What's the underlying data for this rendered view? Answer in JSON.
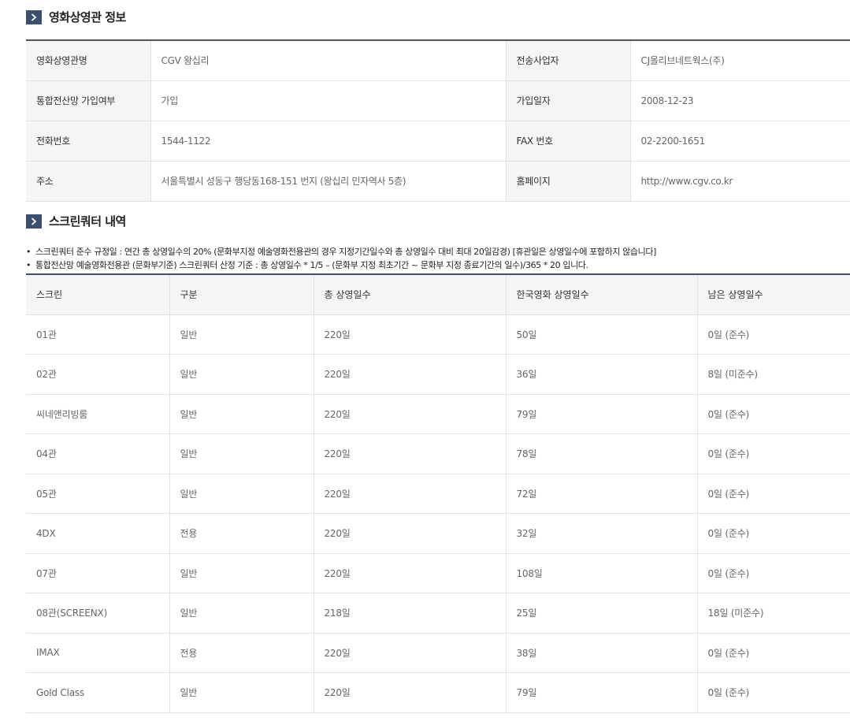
{
  "theater_section": {
    "title": "영화상영관 정보"
  },
  "theater_info": {
    "rows": [
      {
        "label1": "영화상영관명",
        "value1": "CGV 왕십리",
        "label2": "전송사업자",
        "value2": "CJ올리브네트웍스(주)"
      },
      {
        "label1": "통합전산망 가입여부",
        "value1": "가입",
        "label2": "가입일자",
        "value2": "2008-12-23"
      },
      {
        "label1": "전화번호",
        "value1": "1544-1122",
        "label2": "FAX 번호",
        "value2": "02-2200-1651"
      },
      {
        "label1": "주소",
        "value1": "서울특별시 성동구 행당동168-151 번지 (왕십리 민자역사 5층)",
        "label2": "홈페이지",
        "value2": "http://www.cgv.co.kr"
      }
    ]
  },
  "screen_section": {
    "title": "스크린쿼터 내역"
  },
  "notes": [
    "스크린쿼터 준수 규정일 : 연간 총 상영일수의 20% (문화부지정 예술영화전용관의 경우 지정기간일수와 총 상영일수 대비 최대 20일감경) [휴관일은 상영일수에 포함하지 않습니다]",
    "통합전산망 예술영화전용관 (문화부기준) 스크린쿼터 산정 기준 : 총 상영일수 * 1/5 – (문화부 지정 최초기간 ~ 문화부 지정 종료기간의 일수)/365 * 20 입니다."
  ],
  "screen_table": {
    "headers": [
      "스크린",
      "구분",
      "총 상영일수",
      "한국영화 상영일수",
      "남은 상영일수"
    ],
    "rows": [
      [
        "01관",
        "일반",
        "220일",
        "50일",
        "0일 (준수)"
      ],
      [
        "02관",
        "일반",
        "220일",
        "36일",
        "8일 (미준수)"
      ],
      [
        "씨네앤리빙룸",
        "일반",
        "220일",
        "79일",
        "0일 (준수)"
      ],
      [
        "04관",
        "일반",
        "220일",
        "78일",
        "0일 (준수)"
      ],
      [
        "05관",
        "일반",
        "220일",
        "72일",
        "0일 (준수)"
      ],
      [
        "4DX",
        "전용",
        "220일",
        "32일",
        "0일 (준수)"
      ],
      [
        "07관",
        "일반",
        "220일",
        "108일",
        "0일 (준수)"
      ],
      [
        "08관(SCREENX)",
        "일반",
        "218일",
        "25일",
        "18일 (미준수)"
      ],
      [
        "IMAX",
        "전용",
        "220일",
        "38일",
        "0일 (준수)"
      ],
      [
        "Gold Class",
        "일반",
        "220일",
        "79일",
        "0일 (준수)"
      ]
    ]
  }
}
